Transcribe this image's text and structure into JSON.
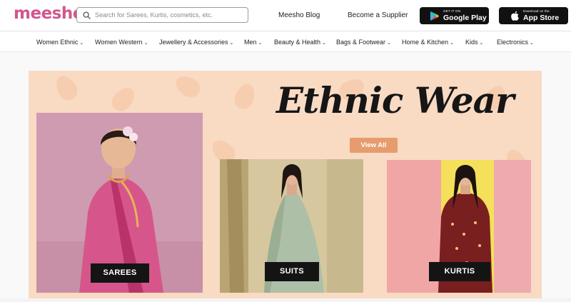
{
  "header": {
    "logo": "meesho",
    "search_placeholder": "Search for Sarees, Kurtis, cosmetics, etc.",
    "blog": "Meesho Blog",
    "supplier": "Become a Supplier",
    "google_play": {
      "small": "GET IT ON",
      "big": "Google Play"
    },
    "app_store": {
      "small": "Download on the",
      "big": "App Store"
    }
  },
  "nav": [
    "Women Ethnic",
    "Women Western",
    "Jewellery & Accessories",
    "Men",
    "Beauty & Health",
    "Bags & Footwear",
    "Home & Kitchen",
    "Kids",
    "Electronics"
  ],
  "banner": {
    "title": "Ethnic Wear",
    "view_all": "View All",
    "cards": [
      {
        "label": "SAREES",
        "image": "woman-in-pink-saree"
      },
      {
        "label": "SUITS",
        "image": "woman-in-sage-anarkali-suit"
      },
      {
        "label": "KURTIS",
        "image": "woman-in-maroon-kurti"
      }
    ]
  },
  "colors": {
    "brand": "#d0578e",
    "banner_bg": "#f9dac3",
    "view_all": "#e69c6c",
    "label_bg": "#141414"
  }
}
